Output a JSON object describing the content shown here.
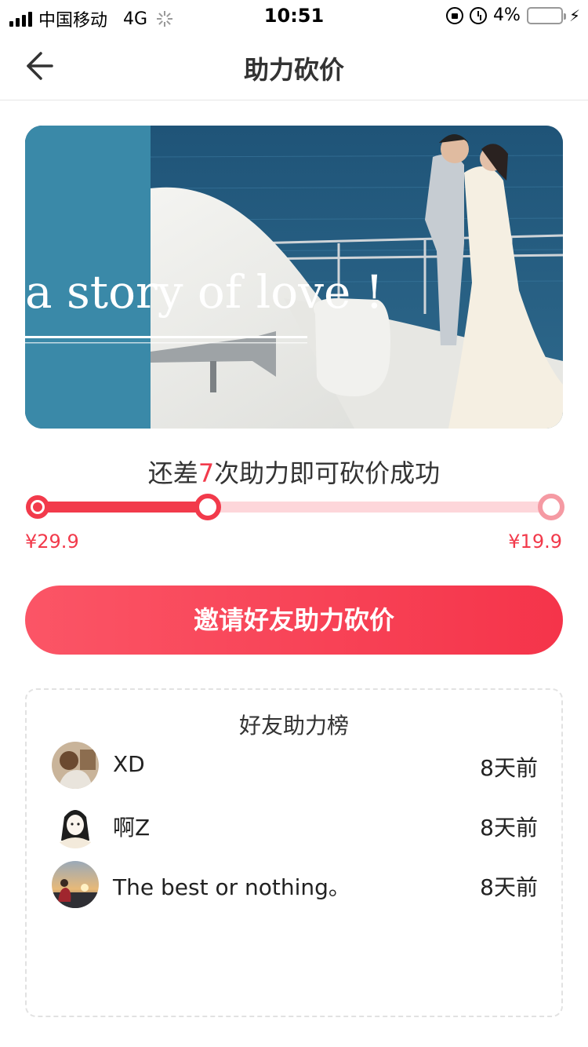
{
  "status_bar": {
    "carrier": "中国移动",
    "network": "4G",
    "time": "10:51",
    "battery_percent": "4%",
    "battery_level": 0.04
  },
  "nav": {
    "title": "助力砍价",
    "back_icon": "arrow-left-icon"
  },
  "hero": {
    "overlay_text": "a story of love !"
  },
  "progress": {
    "tip_prefix": "还差",
    "remaining": "7",
    "tip_suffix": "次助力即可砍价成功",
    "start_price": "¥29.9",
    "end_price": "¥19.9",
    "progress_fraction": 0.33
  },
  "invite_button": {
    "label": "邀请好友助力砍价"
  },
  "ranking": {
    "title": "好友助力榜",
    "rows": [
      {
        "name": "XD",
        "time": "8天前"
      },
      {
        "name": "啊Z",
        "time": "8天前"
      },
      {
        "name": "The best or nothing。",
        "time": "8天前"
      }
    ]
  },
  "colors": {
    "accent": "#f23a4b",
    "track_bg": "#fdd6da"
  }
}
